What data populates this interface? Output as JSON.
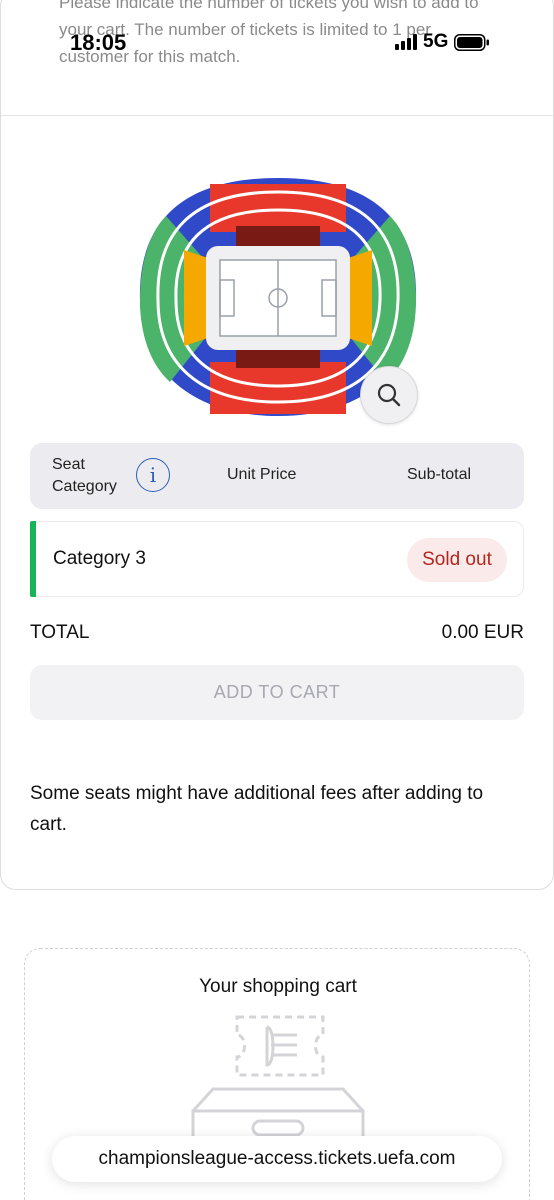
{
  "status_bar": {
    "time": "18:05",
    "network": "5G"
  },
  "intro": {
    "text": "Please indicate the number of tickets you wish to add to your cart. The number of tickets is limited to 1 per customer for this match."
  },
  "table": {
    "header_seat_category": "Seat Category",
    "header_unit_price": "Unit Price",
    "header_subtotal": "Sub-total",
    "rows": [
      {
        "category": "Category 3",
        "status": "Sold out",
        "accent_color": "#18b45a"
      }
    ]
  },
  "total": {
    "label": "TOTAL",
    "value": "0.00 EUR"
  },
  "add_to_cart": {
    "label": "ADD TO CART",
    "disabled": true
  },
  "fees_note": "Some seats might have additional fees after adding to cart.",
  "cart": {
    "title": "Your shopping cart"
  },
  "browser": {
    "url": "championsleague-access.tickets.uefa.com"
  },
  "icons": {
    "signal": "signal-icon",
    "battery": "battery-icon",
    "info": "info-icon",
    "zoom": "magnifier-icon",
    "stadium": "stadium-map-icon"
  },
  "colors": {
    "stadium_blue": "#2f49c9",
    "stadium_red": "#e8382c",
    "stadium_dark_red": "#7a1a14",
    "stadium_green": "#4cb36a",
    "stadium_orange": "#f5a800",
    "sold_out_text": "#b3261e",
    "category_accent": "#18b45a"
  }
}
